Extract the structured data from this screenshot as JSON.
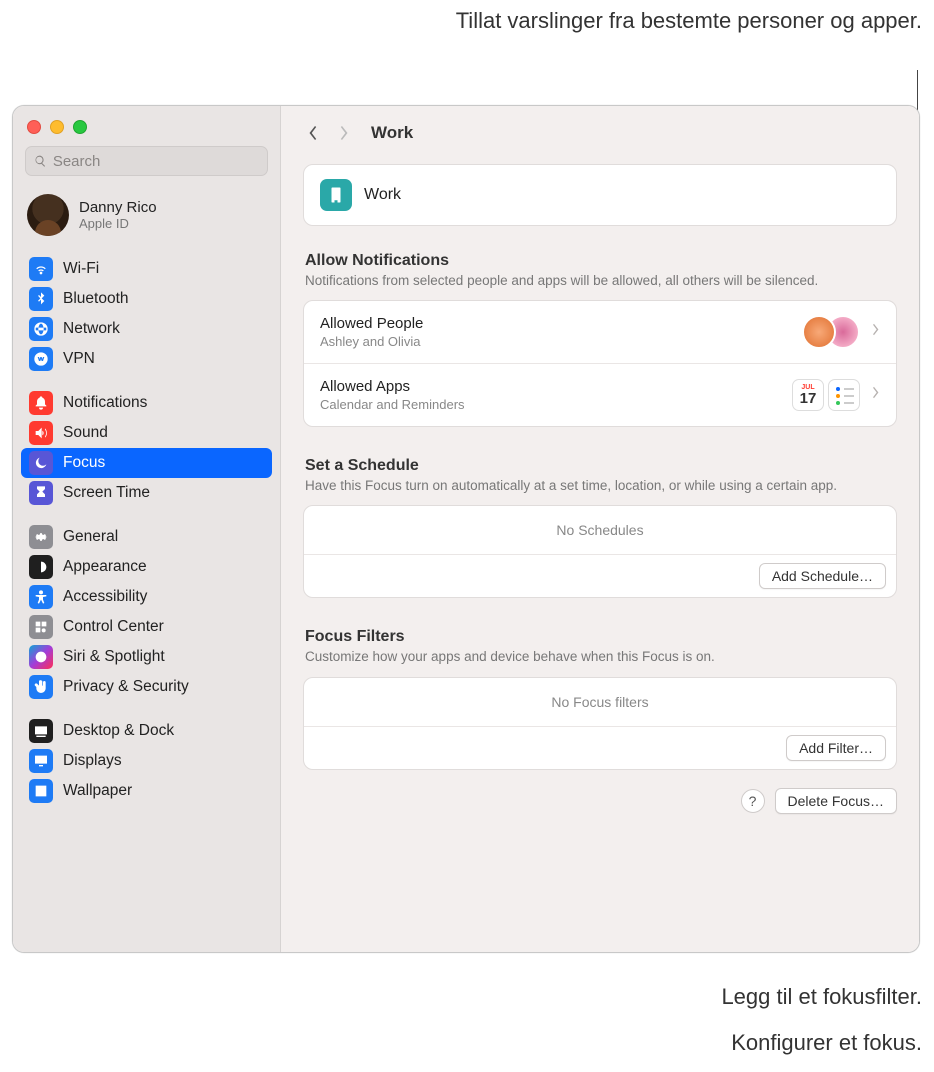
{
  "annotations": {
    "top": "Tillat varslinger fra bestemte personer og apper.",
    "add_filter": "Legg til et fokusfilter.",
    "add_schedule": "Konfigurer et fokus."
  },
  "window": {
    "search_placeholder": "Search",
    "account": {
      "name": "Danny Rico",
      "sub": "Apple ID"
    },
    "title": "Work"
  },
  "sidebar": {
    "groups": [
      [
        {
          "label": "Wi-Fi",
          "icon": "wifi",
          "color": "ic-blue"
        },
        {
          "label": "Bluetooth",
          "icon": "bluetooth",
          "color": "ic-blue"
        },
        {
          "label": "Network",
          "icon": "network",
          "color": "ic-blue"
        },
        {
          "label": "VPN",
          "icon": "vpn",
          "color": "ic-blue"
        }
      ],
      [
        {
          "label": "Notifications",
          "icon": "bell",
          "color": "ic-red"
        },
        {
          "label": "Sound",
          "icon": "sound",
          "color": "ic-red"
        },
        {
          "label": "Focus",
          "icon": "moon",
          "color": "ic-focus",
          "active": true
        },
        {
          "label": "Screen Time",
          "icon": "hourglass",
          "color": "ic-indigo"
        }
      ],
      [
        {
          "label": "General",
          "icon": "gear",
          "color": "ic-gray"
        },
        {
          "label": "Appearance",
          "icon": "appearance",
          "color": "ic-black"
        },
        {
          "label": "Accessibility",
          "icon": "accessibility",
          "color": "ic-blue"
        },
        {
          "label": "Control Center",
          "icon": "controlcenter",
          "color": "ic-gray"
        },
        {
          "label": "Siri & Spotlight",
          "icon": "siri",
          "color": "ic-siri"
        },
        {
          "label": "Privacy & Security",
          "icon": "hand",
          "color": "ic-blue"
        }
      ],
      [
        {
          "label": "Desktop & Dock",
          "icon": "dock",
          "color": "ic-black"
        },
        {
          "label": "Displays",
          "icon": "displays",
          "color": "ic-blue"
        },
        {
          "label": "Wallpaper",
          "icon": "wallpaper",
          "color": "ic-blue"
        }
      ]
    ]
  },
  "focus": {
    "name": "Work",
    "allow": {
      "title": "Allow Notifications",
      "desc": "Notifications from selected people and apps will be allowed, all others will be silenced.",
      "people": {
        "title": "Allowed People",
        "sub": "Ashley and Olivia"
      },
      "apps": {
        "title": "Allowed Apps",
        "sub": "Calendar and Reminders",
        "cal_month": "JUL",
        "cal_day": "17"
      }
    },
    "schedule": {
      "title": "Set a Schedule",
      "desc": "Have this Focus turn on automatically at a set time, location, or while using a certain app.",
      "empty": "No Schedules",
      "button": "Add Schedule…"
    },
    "filters": {
      "title": "Focus Filters",
      "desc": "Customize how your apps and device behave when this Focus is on.",
      "empty": "No Focus filters",
      "button": "Add Filter…"
    },
    "delete": "Delete Focus…"
  }
}
